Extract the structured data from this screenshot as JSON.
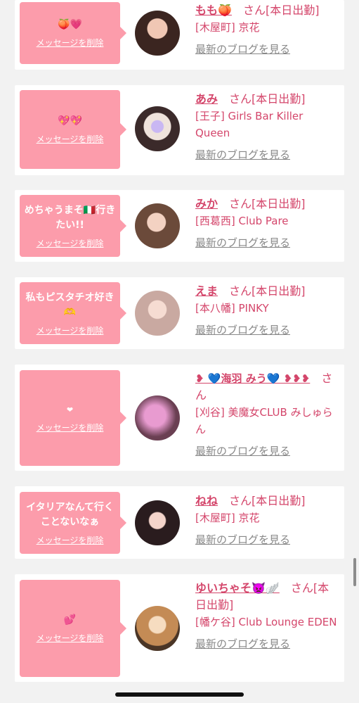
{
  "delete_label": "メッセージを削除",
  "blog_label": "最新のブログを見る",
  "colors": {
    "bubble": "#fc9cab",
    "accent": "#d4466b",
    "background": "#f2f2f2"
  },
  "cards": [
    {
      "message": "🍑💗",
      "name": "もも🍑",
      "san": "さん",
      "status": "[本日出勤]",
      "shop": "[木屋町] 京花"
    },
    {
      "message": "💖💖",
      "name": "あみ",
      "san": "さん",
      "status": "[本日出勤]",
      "shop": "[王子] Girls Bar Killer Queen"
    },
    {
      "message": "めちゃうまそ🇮🇹行きたい!!",
      "name": "みか",
      "san": "さん",
      "status": "[本日出勤]",
      "shop": "[西葛西] Club Pare"
    },
    {
      "message": "私もピスタチオ好き🫶",
      "name": "えま",
      "san": "さん",
      "status": "[本日出勤]",
      "shop": "[本八幡] PINKY"
    },
    {
      "message": "❤",
      "name": "❥ 💙海羽 みう💙 ❥❥❥",
      "san": "さん",
      "status": "",
      "shop": "[刈谷] 美魔女CLUB みしゅらん"
    },
    {
      "message": "イタリアなんて行くことないなぁ",
      "name": "ねね",
      "san": "さん",
      "status": "[本日出勤]",
      "shop": "[木屋町] 京花"
    },
    {
      "message": "💕",
      "name": "ゆいちゃそ👿🪽",
      "san": "さん",
      "status": "[本日出勤]",
      "shop": "[幡ケ谷] Club Lounge EDEN"
    }
  ]
}
